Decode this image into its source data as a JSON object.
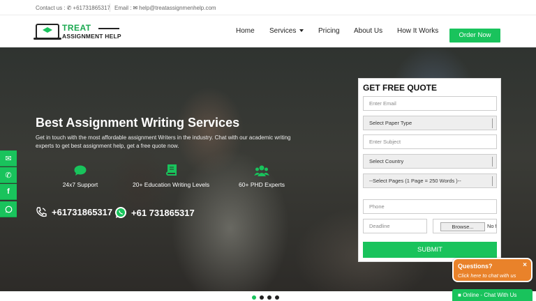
{
  "topbar": {
    "contact_label": "Contact us :",
    "phone": "+61731865317",
    "email_label": "Email :",
    "email": "help@treatassignmenhelp.com"
  },
  "logo": {
    "line1": "TREAT",
    "line2": "ASSIGNMENT HELP"
  },
  "nav": {
    "home": "Home",
    "services": "Services",
    "pricing": "Pricing",
    "about": "About Us",
    "how": "How It Works",
    "order": "Order Now"
  },
  "hero": {
    "title": "Best Assignment Writing Services",
    "subtitle": "Get in touch with the most affordable assignment Writers in the industry. Chat with our academic writing experts to get best assignment help, get a free quote now.",
    "features": [
      {
        "label": "24x7 Support",
        "icon": "chat-bubble-icon"
      },
      {
        "label": "20+ Education Writing Levels",
        "icon": "book-icon"
      },
      {
        "label": "60+ PHD Experts",
        "icon": "users-icon"
      }
    ],
    "phone": "+61731865317",
    "whatsapp": "+61 731865317"
  },
  "quote": {
    "title": "GET FREE QUOTE",
    "email_placeholder": "Enter Email",
    "paper_type": "Select Paper Type",
    "subject_placeholder": "Enter Subject",
    "country": "Select Country",
    "pages": "--Select Pages (1 Page = 250 Words )--",
    "phone_placeholder": "Phone",
    "deadline_placeholder": "Deadline",
    "browse": "Browse...",
    "no_file": "No file selected.",
    "submit": "SUBMIT"
  },
  "chat": {
    "title": "Questions?",
    "subtitle": "Click here to chat with us",
    "close": "×",
    "bar": "Online - Chat With Us"
  },
  "colors": {
    "accent": "#19c35c",
    "chat_orange": "#e9822a"
  }
}
